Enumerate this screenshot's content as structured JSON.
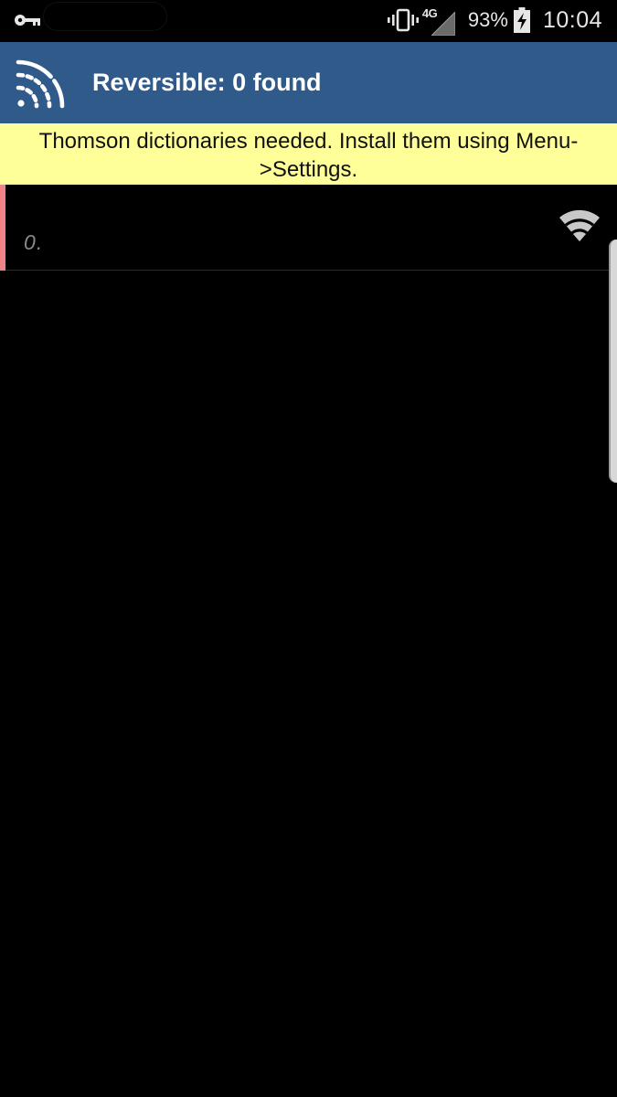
{
  "status_bar": {
    "network_type": "4G",
    "battery_percent": "93%",
    "time": "10:04",
    "icons": [
      "key-icon",
      "vibrate-icon",
      "signal-icon",
      "battery-charging-icon"
    ]
  },
  "app_bar": {
    "title": "Reversible: 0 found",
    "icon": "signal-waves-icon",
    "color": "#2f5a8a"
  },
  "warning": {
    "text": "Thomson dictionaries needed. Install them using Menu->Settings.",
    "background": "#ffff99"
  },
  "list": {
    "items": [
      {
        "value": "0…",
        "icon": "wifi-icon",
        "accent": "#f0828a"
      }
    ]
  }
}
